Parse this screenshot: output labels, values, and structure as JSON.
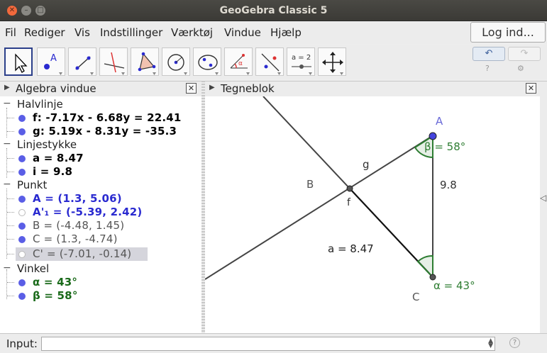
{
  "window": {
    "title": "GeoGebra Classic 5"
  },
  "menu": {
    "items": [
      "Fil",
      "Rediger",
      "Vis",
      "Indstillinger",
      "Værktøj",
      "Vindue",
      "Hjælp"
    ],
    "login": "Log ind..."
  },
  "toolbar": {
    "tools": [
      {
        "icon": "move-arrow-icon"
      },
      {
        "icon": "point-icon"
      },
      {
        "icon": "line-icon"
      },
      {
        "icon": "perpendicular-line-icon"
      },
      {
        "icon": "polygon-icon"
      },
      {
        "icon": "circle-icon"
      },
      {
        "icon": "ellipse-icon"
      },
      {
        "icon": "angle-icon"
      },
      {
        "icon": "reflect-icon"
      },
      {
        "icon": "slider-icon",
        "label": "a = 2"
      },
      {
        "icon": "move-view-icon"
      }
    ],
    "undo": "↶",
    "redo": "↷",
    "help": "?",
    "settings": "⚙"
  },
  "algebra": {
    "title": "Algebra vindue",
    "groups": [
      {
        "label": "Halvlinje",
        "items": [
          {
            "text": "f: -7.17x - 6.68y = 22.41",
            "color": "#000000",
            "visible": true
          },
          {
            "text": "g: 5.19x - 8.31y = -35.3",
            "color": "#000000",
            "visible": true
          }
        ]
      },
      {
        "label": "Linjestykke",
        "items": [
          {
            "text": "a = 8.47",
            "color": "#000000",
            "visible": true
          },
          {
            "text": "i = 9.8",
            "color": "#000000",
            "visible": true
          }
        ]
      },
      {
        "label": "Punkt",
        "items": [
          {
            "text": "A = (1.3, 5.06)",
            "color": "#2a2ad0",
            "visible": true
          },
          {
            "text": "A'₁ = (-5.39, 2.42)",
            "color": "#2a2ad0",
            "visible": false
          },
          {
            "text": "B = (-4.48, 1.45)",
            "color": "#555555",
            "visible": true
          },
          {
            "text": "C = (1.3, -4.74)",
            "color": "#555555",
            "visible": true
          },
          {
            "text": "C' = (-7.01, -0.14)",
            "color": "#555555",
            "visible": false
          }
        ]
      },
      {
        "label": "Vinkel",
        "items": [
          {
            "text": "α = 43°",
            "color": "#1a6a1a",
            "visible": true
          },
          {
            "text": "β = 58°",
            "color": "#1a6a1a",
            "visible": true
          }
        ]
      }
    ]
  },
  "graphics": {
    "title": "Tegneblok",
    "labels": {
      "A": "A",
      "B": "B",
      "C": "C",
      "f": "f",
      "g": "g",
      "seg_i": "9.8",
      "seg_a": "a = 8.47",
      "beta": "β = 58°",
      "alpha": "α = 43°"
    },
    "colors": {
      "point": "#4444dd",
      "angle": "#2e7d32",
      "line": "#444444"
    }
  },
  "input": {
    "label": "Input:",
    "placeholder": ""
  }
}
